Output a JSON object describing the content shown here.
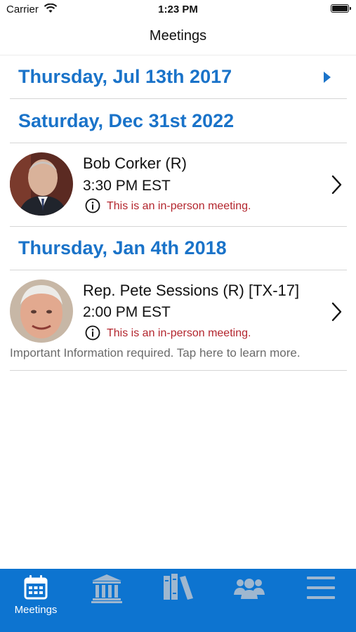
{
  "status": {
    "carrier": "Carrier",
    "time": "1:23 PM"
  },
  "nav": {
    "title": "Meetings"
  },
  "sections": [
    {
      "date": "Thursday, Jul 13th 2017"
    },
    {
      "date": "Saturday, Dec 31st 2022"
    },
    {
      "date": "Thursday, Jan 4th 2018"
    }
  ],
  "meetings": [
    {
      "name": "Bob Corker (R)",
      "time": "3:30 PM EST",
      "note": "This is an in-person meeting."
    },
    {
      "name": "Rep. Pete Sessions (R) [TX-17]",
      "time": "2:00 PM EST",
      "note": "This is an in-person meeting.",
      "notice": "Important Information required. Tap here to learn more."
    }
  ],
  "tabs": [
    {
      "label": "Meetings",
      "icon": "calendar-icon",
      "active": true
    },
    {
      "icon": "capitol-building-icon"
    },
    {
      "icon": "books-icon"
    },
    {
      "icon": "group-icon"
    },
    {
      "icon": "hamburger-menu-icon"
    }
  ],
  "colors": {
    "accent": "#1a73c9",
    "tab_bar": "#0d74d0",
    "warning": "#b3262e",
    "inactive_icon": "#9fb7cf"
  }
}
